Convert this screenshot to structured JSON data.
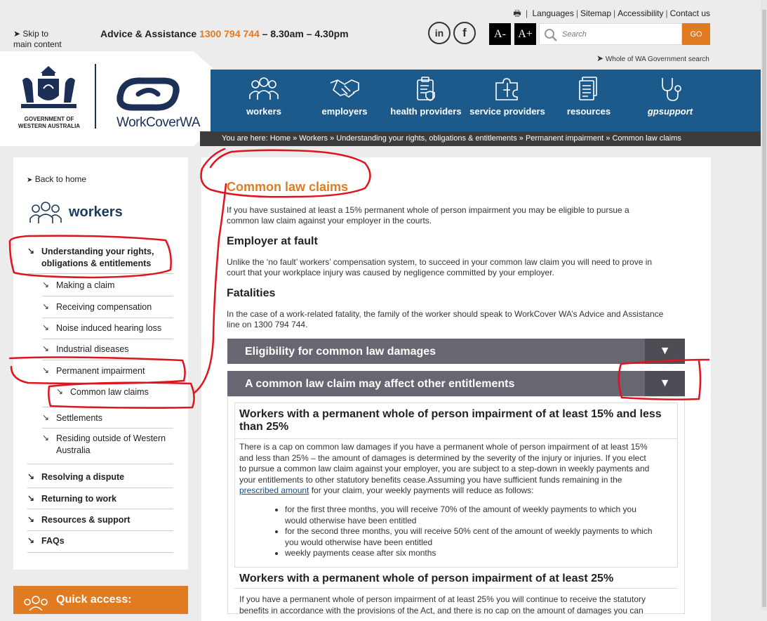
{
  "utility": {
    "print_icon": "print-icon",
    "links": [
      "Languages",
      "Sitemap",
      "Accessibility",
      "Contact us"
    ]
  },
  "skip": {
    "label_1": "Skip to",
    "label_2": "main content"
  },
  "advice": {
    "label": "Advice & Assistance",
    "phone": "1300 794 744",
    "hours": "– 8.30am – 4.30pm"
  },
  "social": {
    "linkedin": "in",
    "facebook": "f"
  },
  "font_size": {
    "decrease": "A-",
    "increase": "A+"
  },
  "search": {
    "placeholder": "Search",
    "button": "GO",
    "wog_link": "Whole of WA Government search"
  },
  "logo": {
    "gov_line_1": "GOVERNMENT OF",
    "gov_line_2": "WESTERN AUSTRALIA",
    "brand": "WorkCoverWA"
  },
  "nav": {
    "items": [
      {
        "label": "workers",
        "icon": "workers-icon"
      },
      {
        "label": "employers",
        "icon": "handshake-icon"
      },
      {
        "label": "health providers",
        "icon": "clipboard-icon"
      },
      {
        "label": "service providers",
        "icon": "puzzle-icon"
      },
      {
        "label": "resources",
        "icon": "document-icon"
      },
      {
        "label": "gpsupport",
        "icon": "stethoscope-icon"
      }
    ]
  },
  "breadcrumb": {
    "prefix": "You are here:",
    "items": [
      "Home",
      "Workers",
      "Understanding your rights, obligations & entitlements",
      "Permanent impairment",
      "Common law claims"
    ]
  },
  "sidebar": {
    "back": "Back to home",
    "title": "workers",
    "items": [
      {
        "label_1": "Understanding your rights,",
        "label_2": "obligations & entitlements"
      },
      {
        "label": "Making a claim"
      },
      {
        "label": "Receiving compensation"
      },
      {
        "label": "Noise induced hearing loss"
      },
      {
        "label": "Industrial diseases"
      },
      {
        "label": "Permanent impairment"
      },
      {
        "label": "Common law claims"
      },
      {
        "label": "Settlements"
      },
      {
        "label_1": "Residing outside of Western",
        "label_2": "Australia"
      },
      {
        "label": "Resolving a dispute"
      },
      {
        "label": "Returning to work"
      },
      {
        "label": "Resources & support"
      },
      {
        "label": "FAQs"
      }
    ],
    "quick_access": "Quick access:"
  },
  "main": {
    "title": "Common law claims",
    "intro_1": "If you have sustained at least a 15% permanent whole of person impairment you may be eligible to pursue a",
    "intro_2": "common law claim against your employer in the courts.",
    "h_fault": "Employer at fault",
    "fault_1": "Unlike the ‘no fault’ workers’ compensation system, to succeed in your common law claim you will need to prove in",
    "fault_2": "court that your workplace injury was caused by negligence committed by your employer.",
    "h_fatal": "Fatalities",
    "fatal_1": "In the case of a work-related fatality, the family of the worker should speak to WorkCover WA’s Advice and Assistance",
    "fatal_2": "line on 1300 794 744.",
    "accordions": [
      {
        "title": "Eligibility for common law damages",
        "toggle": "▼"
      },
      {
        "title": "A common law claim may affect other entitlements",
        "toggle": "▼"
      }
    ],
    "sub1": {
      "heading_1": "Workers with a permanent whole of person impairment of at least 15% and less",
      "heading_2": "than 25%",
      "p1": "There is a cap on common law damages if you have a permanent whole of person impairment of at least 15%",
      "p2": "and less than 25% – the amount of damages is determined by the severity of the injury or injuries. If you elect",
      "p3": "to pursue a common law claim against your employer, you are subject to a step-down in weekly payments and",
      "p4": "your entitlements to other statutory benefits cease.Assuming you have sufficient funds remaining in the",
      "link": "prescribed amount",
      "p5_after": " for your claim, your weekly payments will reduce as follows:",
      "bullets": [
        {
          "l1": "for the first three months, you will receive 70% of the amount of weekly payments to which you",
          "l2": "would otherwise have been entitled"
        },
        {
          "l1": "for the second three months, you will receive 50% cent of the amount of weekly payments to which",
          "l2": "you would otherwise have been entitled"
        },
        {
          "l1": "weekly payments cease after six months",
          "l2": ""
        }
      ]
    },
    "sub2": {
      "heading": "Workers with a permanent whole of person impairment of at least 25%",
      "p1": "If you have a permanent whole of person impairment of at least 25% you will continue to receive the statutory",
      "p2": "benefits in accordance with the provisions of the Act, and there is no cap on the amount of damages you can"
    }
  },
  "colors": {
    "accent": "#e07b22",
    "nav": "#1d5a8c",
    "annotation": "#e0141e",
    "accordion": "#666770"
  }
}
